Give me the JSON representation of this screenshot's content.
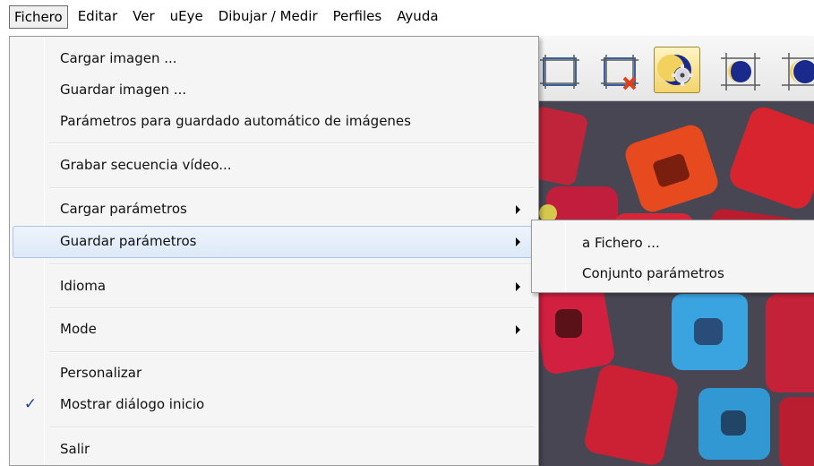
{
  "menubar": {
    "items": [
      "Fichero",
      "Editar",
      "Ver",
      "uEye",
      "Dibujar / Medir",
      "Perfiles",
      "Ayuda"
    ],
    "active": "Fichero"
  },
  "toolbar": {
    "icons": [
      "grid-frame-icon",
      "grid-delete-icon",
      "moon-gear-icon",
      "moon-icon",
      "moon-icon"
    ],
    "selected": "moon-gear-icon"
  },
  "file_menu": {
    "load_image": "Cargar imagen ...",
    "save_image": "Guardar imagen ...",
    "autosave_params": "Parámetros para guardado automático de imágenes",
    "record_video": "Grabar secuencia vídeo...",
    "load_params": "Cargar parámetros",
    "save_params": "Guardar parámetros",
    "language": "Idioma",
    "mode": "Mode",
    "customize": "Personalizar",
    "show_start_dialog": "Mostrar diálogo inicio",
    "exit": "Salir",
    "check_mark": "✓"
  },
  "save_params_submenu": {
    "to_file": "a Fichero ...",
    "param_set": "Conjunto parámetros"
  },
  "colors": {
    "menu_bg": "#f5f5f5",
    "highlight_border": "#a8c6ee",
    "check": "#1b3f90"
  }
}
